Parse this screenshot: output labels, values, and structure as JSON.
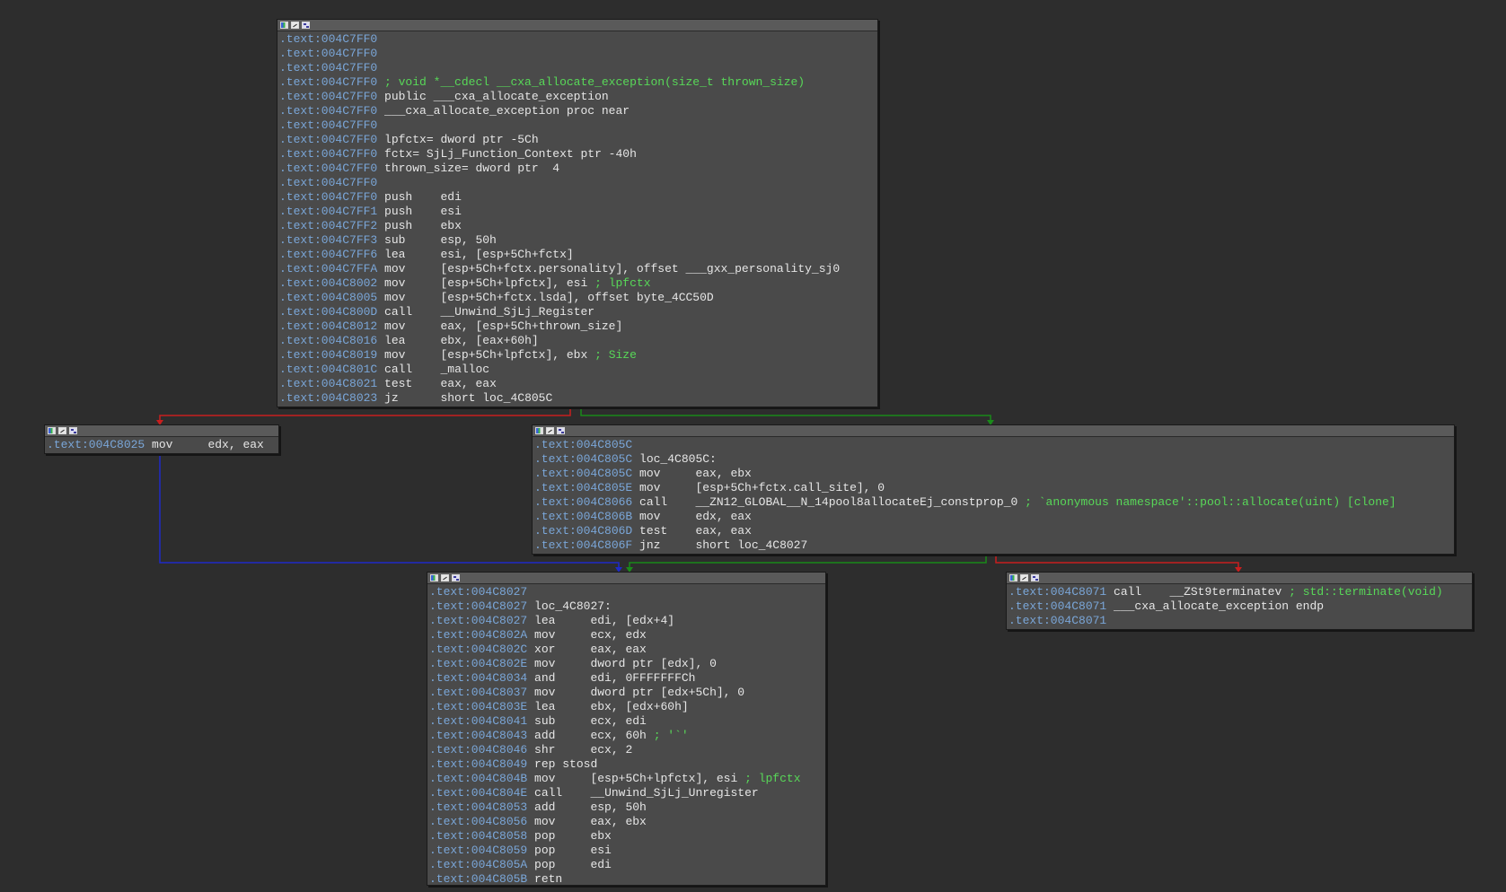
{
  "colors": {
    "background": "#2d2d2d",
    "block_bg": "#4a4a4a",
    "address": "#7aa6d8",
    "comment": "#58d858",
    "edge_true": "#1a8a1a",
    "edge_false": "#c81e1e",
    "edge_uncond": "#1e2ac8"
  },
  "blocks": [
    {
      "id": "main",
      "lines": [
        [
          ".text:004C7FF0",
          "",
          "",
          ""
        ],
        [
          ".text:004C7FF0",
          "",
          "",
          ""
        ],
        [
          ".text:004C7FF0",
          "",
          "",
          ""
        ],
        [
          ".text:004C7FF0",
          "",
          "",
          "; void *__cdecl __cxa_allocate_exception(size_t thrown_size)"
        ],
        [
          ".text:004C7FF0",
          "public ___cxa_allocate_exception",
          "",
          ""
        ],
        [
          ".text:004C7FF0",
          "___cxa_allocate_exception proc near",
          "",
          ""
        ],
        [
          ".text:004C7FF0",
          "",
          "",
          ""
        ],
        [
          ".text:004C7FF0",
          "lpfctx= dword ptr -5Ch",
          "",
          ""
        ],
        [
          ".text:004C7FF0",
          "fctx= SjLj_Function_Context ptr -40h",
          "",
          ""
        ],
        [
          ".text:004C7FF0",
          "thrown_size= dword ptr  4",
          "",
          ""
        ],
        [
          ".text:004C7FF0",
          "",
          "",
          ""
        ],
        [
          ".text:004C7FF0",
          "push",
          "edi",
          ""
        ],
        [
          ".text:004C7FF1",
          "push",
          "esi",
          ""
        ],
        [
          ".text:004C7FF2",
          "push",
          "ebx",
          ""
        ],
        [
          ".text:004C7FF3",
          "sub",
          "esp, 50h",
          ""
        ],
        [
          ".text:004C7FF6",
          "lea",
          "esi, [esp+5Ch+fctx]",
          ""
        ],
        [
          ".text:004C7FFA",
          "mov",
          "[esp+5Ch+fctx.personality], offset ___gxx_personality_sj0",
          ""
        ],
        [
          ".text:004C8002",
          "mov",
          "[esp+5Ch+lpfctx], esi",
          "; lpfctx"
        ],
        [
          ".text:004C8005",
          "mov",
          "[esp+5Ch+fctx.lsda], offset byte_4CC50D",
          ""
        ],
        [
          ".text:004C800D",
          "call",
          "__Unwind_SjLj_Register",
          ""
        ],
        [
          ".text:004C8012",
          "mov",
          "eax, [esp+5Ch+thrown_size]",
          ""
        ],
        [
          ".text:004C8016",
          "lea",
          "ebx, [eax+60h]",
          ""
        ],
        [
          ".text:004C8019",
          "mov",
          "[esp+5Ch+lpfctx], ebx",
          "; Size"
        ],
        [
          ".text:004C801C",
          "call",
          "_malloc",
          ""
        ],
        [
          ".text:004C8021",
          "test",
          "eax, eax",
          ""
        ],
        [
          ".text:004C8023",
          "jz",
          "short loc_4C805C",
          ""
        ]
      ]
    },
    {
      "id": "mov-edx",
      "lines": [
        [
          ".text:004C8025",
          "mov",
          "edx, eax",
          ""
        ]
      ]
    },
    {
      "id": "loc-805c",
      "lines": [
        [
          ".text:004C805C",
          "",
          "",
          ""
        ],
        [
          ".text:004C805C",
          "loc_4C805C:",
          "",
          ""
        ],
        [
          ".text:004C805C",
          "mov",
          "eax, ebx",
          ""
        ],
        [
          ".text:004C805E",
          "mov",
          "[esp+5Ch+fctx.call_site], 0",
          ""
        ],
        [
          ".text:004C8066",
          "call",
          "__ZN12_GLOBAL__N_14pool8allocateEj_constprop_0",
          "; `anonymous namespace'::pool::allocate(uint) [clone]"
        ],
        [
          ".text:004C806B",
          "mov",
          "edx, eax",
          ""
        ],
        [
          ".text:004C806D",
          "test",
          "eax, eax",
          ""
        ],
        [
          ".text:004C806F",
          "jnz",
          "short loc_4C8027",
          ""
        ]
      ]
    },
    {
      "id": "loc-8027",
      "lines": [
        [
          ".text:004C8027",
          "",
          "",
          ""
        ],
        [
          ".text:004C8027",
          "loc_4C8027:",
          "",
          ""
        ],
        [
          ".text:004C8027",
          "lea",
          "edi, [edx+4]",
          ""
        ],
        [
          ".text:004C802A",
          "mov",
          "ecx, edx",
          ""
        ],
        [
          ".text:004C802C",
          "xor",
          "eax, eax",
          ""
        ],
        [
          ".text:004C802E",
          "mov",
          "dword ptr [edx], 0",
          ""
        ],
        [
          ".text:004C8034",
          "and",
          "edi, 0FFFFFFFCh",
          ""
        ],
        [
          ".text:004C8037",
          "mov",
          "dword ptr [edx+5Ch], 0",
          ""
        ],
        [
          ".text:004C803E",
          "lea",
          "ebx, [edx+60h]",
          ""
        ],
        [
          ".text:004C8041",
          "sub",
          "ecx, edi",
          ""
        ],
        [
          ".text:004C8043",
          "add",
          "ecx, 60h",
          "; '`'"
        ],
        [
          ".text:004C8046",
          "shr",
          "ecx, 2",
          ""
        ],
        [
          ".text:004C8049",
          "rep stosd",
          "",
          ""
        ],
        [
          ".text:004C804B",
          "mov",
          "[esp+5Ch+lpfctx], esi",
          "; lpfctx"
        ],
        [
          ".text:004C804E",
          "call",
          "__Unwind_SjLj_Unregister",
          ""
        ],
        [
          ".text:004C8053",
          "add",
          "esp, 50h",
          ""
        ],
        [
          ".text:004C8056",
          "mov",
          "eax, ebx",
          ""
        ],
        [
          ".text:004C8058",
          "pop",
          "ebx",
          ""
        ],
        [
          ".text:004C8059",
          "pop",
          "esi",
          ""
        ],
        [
          ".text:004C805A",
          "pop",
          "edi",
          ""
        ],
        [
          ".text:004C805B",
          "retn",
          "",
          ""
        ]
      ]
    },
    {
      "id": "terminate",
      "lines": [
        [
          ".text:004C8071",
          "call",
          "__ZSt9terminatev",
          "; std::terminate(void)"
        ],
        [
          ".text:004C8071",
          "___cxa_allocate_exception endp",
          "",
          ""
        ],
        [
          ".text:004C8071",
          "",
          "",
          ""
        ]
      ]
    }
  ]
}
